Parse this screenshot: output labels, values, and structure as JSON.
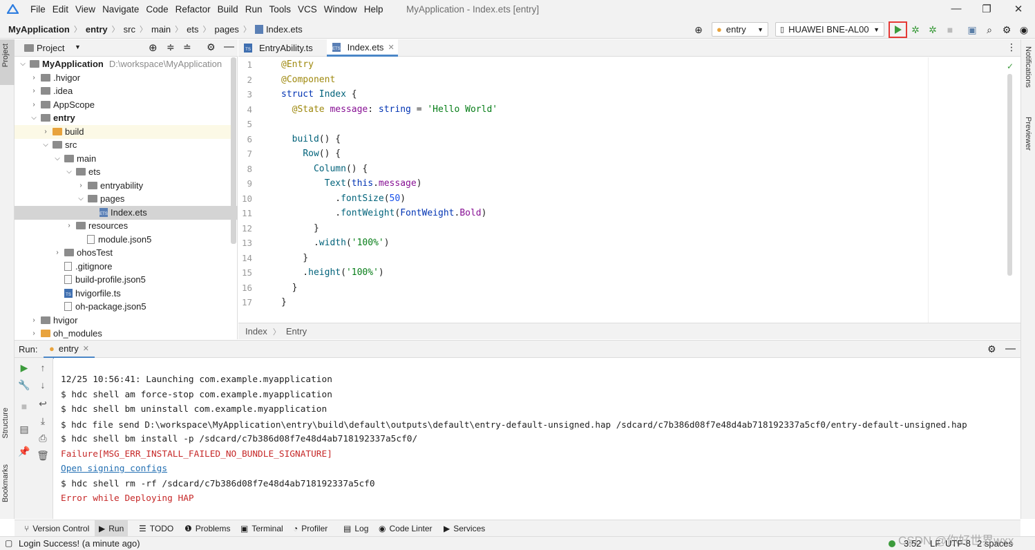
{
  "window": {
    "title": "MyApplication - Index.ets [entry]",
    "menu": [
      "File",
      "Edit",
      "View",
      "Navigate",
      "Code",
      "Refactor",
      "Build",
      "Run",
      "Tools",
      "VCS",
      "Window",
      "Help"
    ],
    "minimize": "—",
    "maximize": "❐",
    "close": "✕"
  },
  "navbar": {
    "breadcrumb": [
      "MyApplication",
      "entry",
      "src",
      "main",
      "ets",
      "pages",
      "Index.ets"
    ],
    "module_selector": "entry",
    "device_selector": "HUAWEI BNE-AL00",
    "accent_run": "#3c9b3c",
    "highlight_box": "#e53935"
  },
  "left_strip": {
    "project": "Project",
    "structure": "Structure",
    "bookmarks": "Bookmarks"
  },
  "right_strip": {
    "notifications": "Notifications",
    "previewer": "Previewer"
  },
  "project_panel": {
    "title": "Project",
    "tree": [
      {
        "label": "MyApplication",
        "path": "D:\\workspace\\MyApplication"
      },
      {
        "label": ".hvigor"
      },
      {
        "label": ".idea"
      },
      {
        "label": "AppScope"
      },
      {
        "label": "entry"
      },
      {
        "label": "build"
      },
      {
        "label": "src"
      },
      {
        "label": "main"
      },
      {
        "label": "ets"
      },
      {
        "label": "entryability"
      },
      {
        "label": "pages"
      },
      {
        "label": "Index.ets"
      },
      {
        "label": "resources"
      },
      {
        "label": "module.json5"
      },
      {
        "label": "ohosTest"
      },
      {
        "label": ".gitignore"
      },
      {
        "label": "build-profile.json5"
      },
      {
        "label": "hvigorfile.ts"
      },
      {
        "label": "oh-package.json5"
      },
      {
        "label": "hvigor"
      },
      {
        "label": "oh_modules"
      }
    ]
  },
  "editor": {
    "tabs": [
      "EntryAbility.ts",
      "Index.ets"
    ],
    "line_numbers": [
      "1",
      "2",
      "3",
      "4",
      "5",
      "6",
      "7",
      "8",
      "9",
      "10",
      "11",
      "12",
      "13",
      "14",
      "15",
      "16",
      "17"
    ],
    "breadcrumb": [
      "Index",
      "Entry"
    ]
  },
  "run_panel": {
    "label": "Run:",
    "tab": "entry",
    "console": [
      "12/25 10:56:41: Launching com.example.myapplication",
      "$ hdc shell am force-stop com.example.myapplication",
      "$ hdc shell bm uninstall com.example.myapplication",
      "$ hdc file send D:\\workspace\\MyApplication\\entry\\build\\default\\outputs\\default\\entry-default-unsigned.hap /sdcard/c7b386d08f7e48d4ab718192337a5cf0/entry-default-unsigned.hap",
      "$ hdc shell bm install -p /sdcard/c7b386d08f7e48d4ab718192337a5cf0/",
      "Failure[MSG_ERR_INSTALL_FAILED_NO_BUNDLE_SIGNATURE]",
      "Open signing configs",
      "$ hdc shell rm -rf /sdcard/c7b386d08f7e48d4ab718192337a5cf0",
      "Error while Deploying HAP"
    ]
  },
  "tool_tabs": [
    "Version Control",
    "Run",
    "TODO",
    "Problems",
    "Terminal",
    "Profiler",
    "Log",
    "Code Linter",
    "Services"
  ],
  "status": {
    "message": "Login Success! (a minute ago)",
    "position": "3:52",
    "line_sep": "LF",
    "encoding": "UTF-8",
    "indent": "2 spaces",
    "watermark": "CSDN @你好世界wxx"
  }
}
